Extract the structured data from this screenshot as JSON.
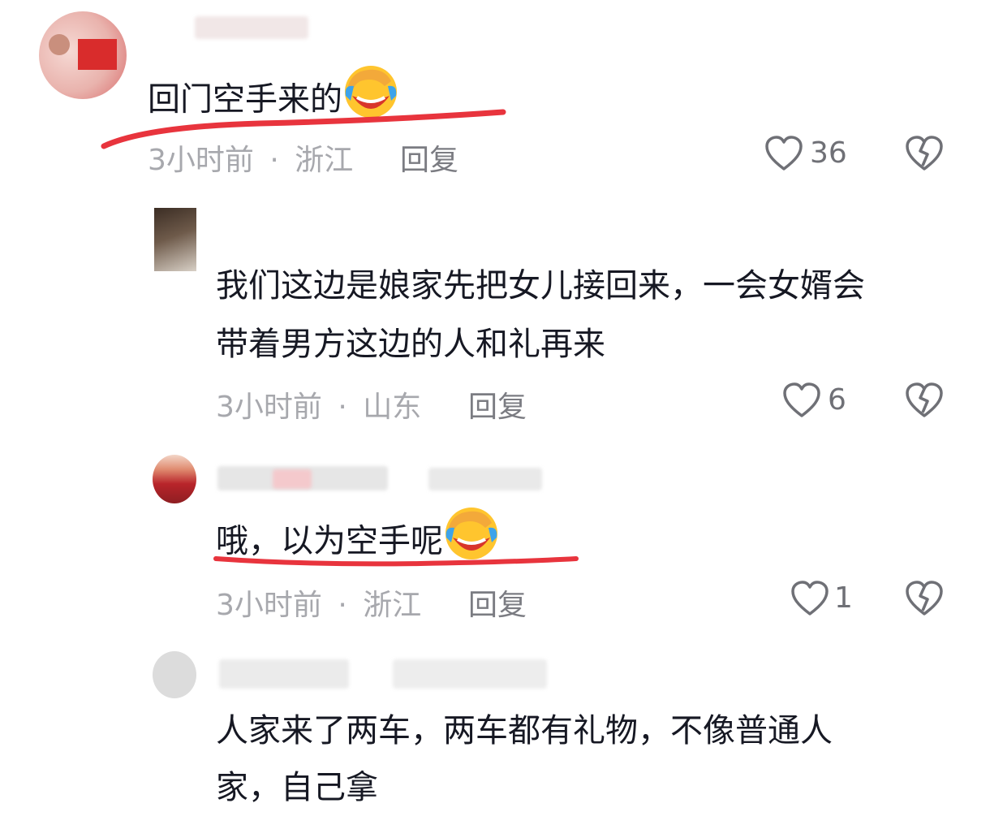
{
  "comments": [
    {
      "text": "回门空手来的",
      "emoji": "face-with-hand-over-eyes-laughing",
      "time": "3小时前",
      "separator": "·",
      "location": "浙江",
      "reply_label": "回复",
      "likes": "36"
    },
    {
      "text_line1": "我们这边是娘家先把女儿接回来，一会女婿会",
      "text_line2": "带着男方这边的人和礼再来",
      "time": "3小时前",
      "separator": "·",
      "location": "山东",
      "reply_label": "回复",
      "likes": "6"
    },
    {
      "text": "哦，以为空手呢",
      "emoji": "face-with-hand-over-eyes-laughing",
      "time": "3小时前",
      "separator": "·",
      "location": "浙江",
      "reply_label": "回复",
      "likes": "1"
    },
    {
      "text_line1": "人家来了两车，两车都有礼物，不像普通人",
      "text_line2": "家，自己拿"
    }
  ],
  "colors": {
    "underline": "#e8343d",
    "meta": "#a7a8ad",
    "icon": "#6f7076"
  }
}
